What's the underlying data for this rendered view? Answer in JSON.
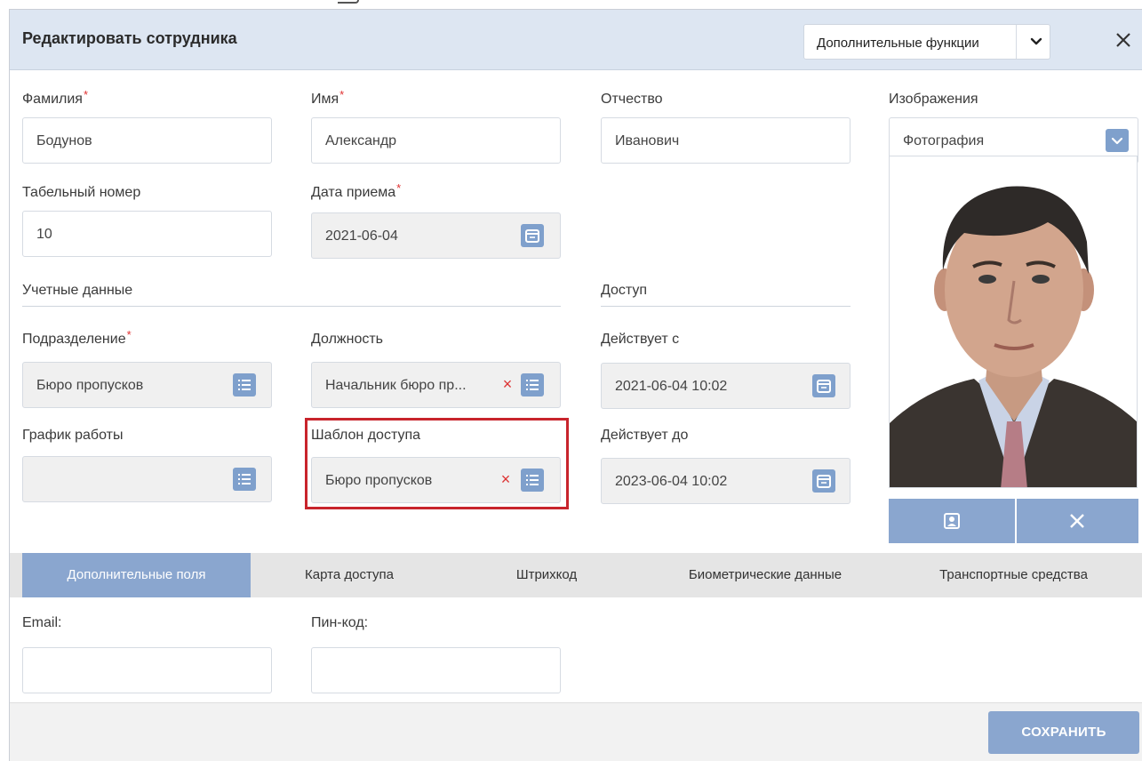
{
  "header": {
    "title": "Редактировать сотрудника",
    "extra_functions_label": "Дополнительные функции"
  },
  "required_mark": "*",
  "fields": {
    "last_name": {
      "label": "Фамилия",
      "value": "Бодунов"
    },
    "first_name": {
      "label": "Имя",
      "value": "Александр"
    },
    "patronymic": {
      "label": "Отчество",
      "value": "Иванович"
    },
    "personnel_number": {
      "label": "Табельный номер",
      "value": "10"
    },
    "hire_date": {
      "label": "Дата приема",
      "value": "2021-06-04"
    },
    "department": {
      "label": "Подразделение",
      "value": "Бюро пропусков"
    },
    "position": {
      "label": "Должность",
      "value": "Начальник бюро пр..."
    },
    "work_schedule": {
      "label": "График работы",
      "value": ""
    },
    "access_template": {
      "label": "Шаблон доступа",
      "value": "Бюро пропусков"
    },
    "valid_from": {
      "label": "Действует с",
      "value": "2021-06-04 10:02"
    },
    "valid_to": {
      "label": "Действует до",
      "value": "2023-06-04 10:02"
    }
  },
  "sections": {
    "credentials": "Учетные данные",
    "access": "Доступ"
  },
  "images": {
    "label": "Изображения",
    "selected": "Фотография"
  },
  "tabs": [
    {
      "label": "Дополнительные поля",
      "active": true
    },
    {
      "label": "Карта доступа",
      "active": false
    },
    {
      "label": "Штрихкод",
      "active": false
    },
    {
      "label": "Биометрические данные",
      "active": false
    },
    {
      "label": "Транспортные средства",
      "active": false
    }
  ],
  "extra_fields": {
    "email": {
      "label": "Email:",
      "value": ""
    },
    "pin": {
      "label": "Пин-код:",
      "value": ""
    }
  },
  "footer": {
    "save_label": "СОХРАНИТЬ"
  },
  "colors": {
    "header_bg": "#dde6f2",
    "accent": "#8aa6cf",
    "icon_button": "#7fa0cc",
    "required": "#e03131",
    "highlight": "#c8242c"
  },
  "icons": {
    "list": "list-icon",
    "calendar": "calendar-icon",
    "clear": "clear-icon",
    "close": "close-icon",
    "chevron": "chevron-down-icon",
    "portrait": "portrait-icon"
  }
}
